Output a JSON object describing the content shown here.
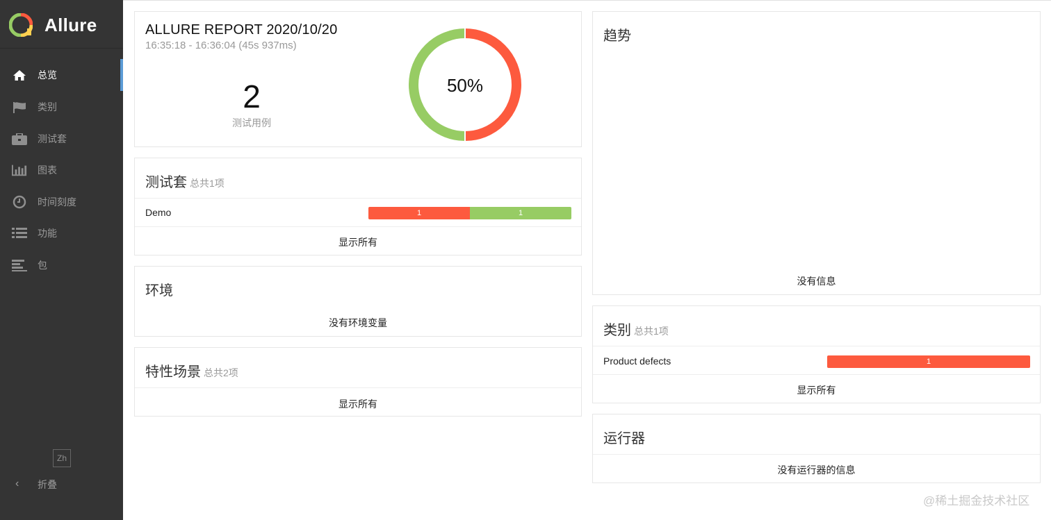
{
  "brand": {
    "name": "Allure",
    "logo_colors": [
      "#fd5a3e",
      "#97cc64",
      "#ffd050",
      "#4a90d9"
    ]
  },
  "sidebar": {
    "items": [
      {
        "label": "总览",
        "icon": "home-icon",
        "active": true
      },
      {
        "label": "类别",
        "icon": "flag-icon",
        "active": false
      },
      {
        "label": "测试套",
        "icon": "briefcase-icon",
        "active": false
      },
      {
        "label": "图表",
        "icon": "bar-chart-icon",
        "active": false
      },
      {
        "label": "时间刻度",
        "icon": "clock-icon",
        "active": false
      },
      {
        "label": "功能",
        "icon": "list-icon",
        "active": false
      },
      {
        "label": "包",
        "icon": "align-left-icon",
        "active": false
      }
    ],
    "language": "Zh",
    "collapse_label": "折叠"
  },
  "summary": {
    "title": "ALLURE REPORT 2020/10/20",
    "time_range": "16:35:18 - 16:36:04 (45s 937ms)",
    "test_count": "2",
    "test_count_label": "测试用例",
    "percent_label": "50%",
    "passed_fraction": 0.5,
    "colors": {
      "passed": "#97cc64",
      "failed": "#fd5a3e"
    }
  },
  "suites": {
    "title": "测试套",
    "count_label": "总共1项",
    "rows": [
      {
        "name": "Demo",
        "failed": "1",
        "passed": "1"
      }
    ],
    "show_all": "显示所有"
  },
  "environment": {
    "title": "环境",
    "empty": "没有环境变量"
  },
  "features": {
    "title": "特性场景",
    "count_label": "总共2项",
    "show_all": "显示所有"
  },
  "trend": {
    "title": "趋势",
    "empty": "没有信息"
  },
  "categories": {
    "title": "类别",
    "count_label": "总共1项",
    "rows": [
      {
        "name": "Product defects",
        "failed": "1"
      }
    ],
    "show_all": "显示所有"
  },
  "executors": {
    "title": "运行器",
    "empty": "没有运行器的信息"
  },
  "watermark": "@稀土掘金技术社区"
}
